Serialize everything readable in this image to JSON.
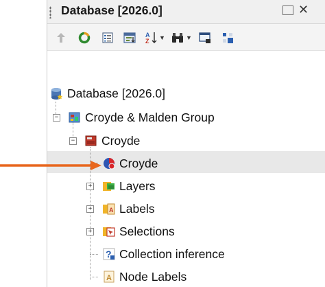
{
  "panel": {
    "title": "Database [2026.0]",
    "restore_label": "",
    "close_label": "✕"
  },
  "toolbar": {
    "buttons": [
      "up-arrow-icon",
      "refresh-icon",
      "properties-icon",
      "sort-by-icon",
      "sort-az-icon",
      "find-icon",
      "window-icon",
      "grid-icon"
    ]
  },
  "tree": {
    "items": [
      {
        "label": "Database [2026.0]",
        "icon": "database-icon"
      },
      {
        "label": "Croyde & Malden Group",
        "icon": "group-icon",
        "expander": "−"
      },
      {
        "label": "Croyde",
        "icon": "network-icon",
        "expander": "−"
      },
      {
        "label": "Croyde",
        "icon": "model-icon",
        "selected": true
      },
      {
        "label": "Layers",
        "icon": "layers-icon",
        "expander": "+"
      },
      {
        "label": "Labels",
        "icon": "labels-icon",
        "expander": "+"
      },
      {
        "label": "Selections",
        "icon": "selections-icon",
        "expander": "+"
      },
      {
        "label": "Collection inference",
        "icon": "inference-icon"
      },
      {
        "label": "Node Labels",
        "icon": "node-labels-icon"
      }
    ]
  },
  "annotation": {
    "color": "#e8671e"
  },
  "colors": {
    "selection": "#e8e8e8",
    "titlebar": "#f0f0f0"
  }
}
